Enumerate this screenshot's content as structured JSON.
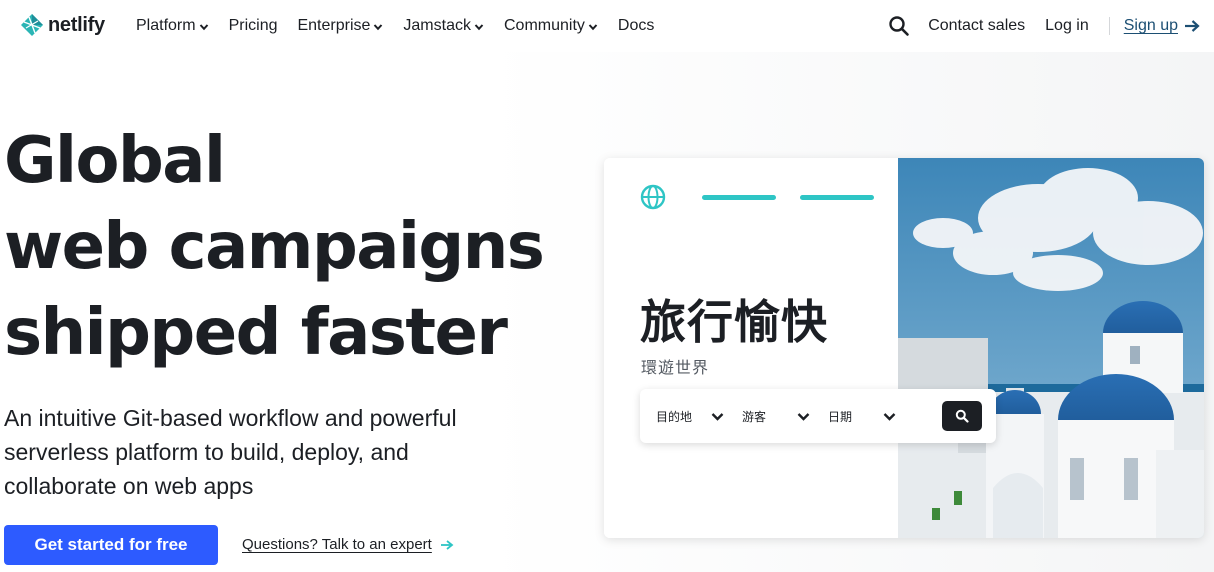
{
  "nav": {
    "logo_text": "netlify",
    "links": [
      "Platform",
      "Pricing",
      "Enterprise",
      "Jamstack",
      "Community",
      "Docs"
    ],
    "contact_sales": "Contact sales",
    "log_in": "Log in",
    "sign_up": "Sign up"
  },
  "hero": {
    "title_line1": "Global",
    "title_line2": "web campaigns",
    "title_line3": "shipped faster",
    "subtitle": "An intuitive Git-based workflow and powerful serverless platform to build, deploy, and collaborate on web apps",
    "cta_primary": "Get started for free",
    "cta_secondary": "Questions? Talk to an expert"
  },
  "card": {
    "title": "旅行愉快",
    "subtitle": "環遊世界",
    "fields": [
      "目的地",
      "游客",
      "日期"
    ],
    "accent_color": "#2ec5c5"
  },
  "colors": {
    "brand_blue": "#2d5bff",
    "text": "#1c1f24",
    "teal": "#2ec5c5"
  }
}
